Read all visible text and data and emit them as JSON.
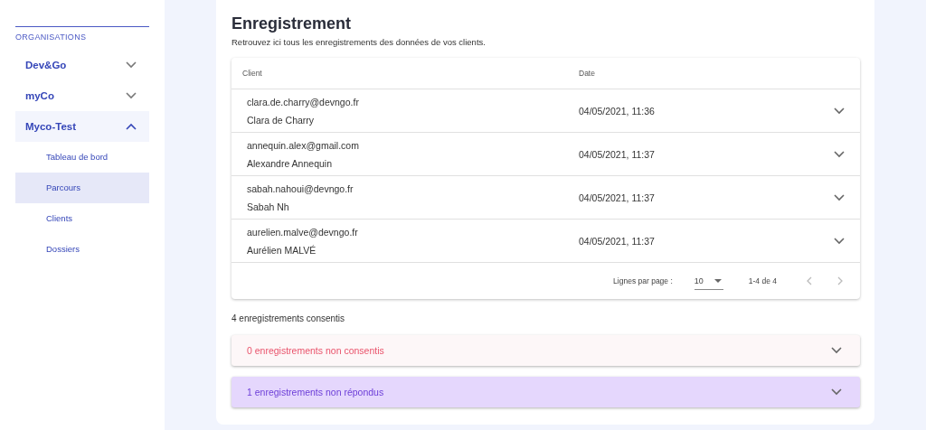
{
  "sidebar": {
    "section_title": "ORGANISATIONS",
    "organisations": [
      {
        "label": "Dev&Go",
        "expanded": false
      },
      {
        "label": "myCo",
        "expanded": false
      },
      {
        "label": "Myco-Test",
        "expanded": true,
        "children": [
          {
            "label": "Tableau de bord",
            "selected": false
          },
          {
            "label": "Parcours",
            "selected": true
          },
          {
            "label": "Clients",
            "selected": false
          },
          {
            "label": "Dossiers",
            "selected": false
          }
        ]
      }
    ]
  },
  "page": {
    "title": "Enregistrement",
    "subtitle": "Retrouvez ici tous les enregistrements des données de vos clients."
  },
  "table": {
    "columns": [
      "Client",
      "Date"
    ],
    "rows": [
      {
        "email": "clara.de.charry@devngo.fr",
        "name": "Clara de Charry",
        "date": "04/05/2021, 11:36"
      },
      {
        "email": "annequin.alex@gmail.com",
        "name": "Alexandre Annequin",
        "date": "04/05/2021, 11:37"
      },
      {
        "email": "sabah.nahoui@devngo.fr",
        "name": "Sabah Nh",
        "date": "04/05/2021, 11:37"
      },
      {
        "email": "aurelien.malve@devngo.fr",
        "name": "Aurélien MALVÉ",
        "date": "04/05/2021, 11:37"
      }
    ],
    "pagination": {
      "rows_per_page_label": "Lignes par page :",
      "rows_per_page": "10",
      "range": "1-4 de 4"
    }
  },
  "consented_summary": "4 enregistrements consentis",
  "panels": [
    {
      "kind": "refused",
      "label": "0 enregistrements non consentis"
    },
    {
      "kind": "unanswered",
      "label": "1 enregistrements non répondus"
    }
  ]
}
